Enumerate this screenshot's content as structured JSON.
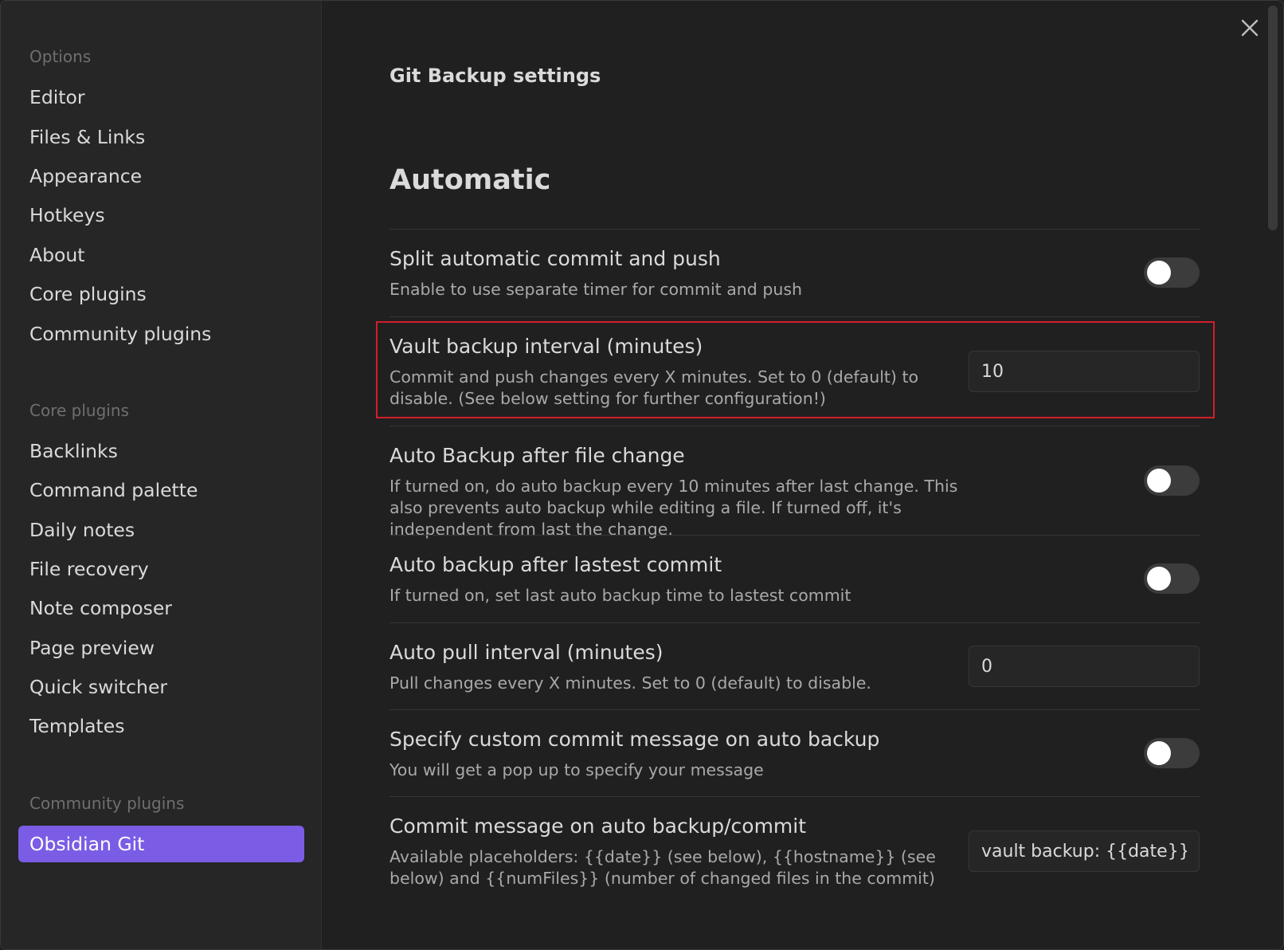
{
  "sidebar": {
    "options_heading": "Options",
    "options": [
      "Editor",
      "Files & Links",
      "Appearance",
      "Hotkeys",
      "About",
      "Core plugins",
      "Community plugins"
    ],
    "core_heading": "Core plugins",
    "core": [
      "Backlinks",
      "Command palette",
      "Daily notes",
      "File recovery",
      "Note composer",
      "Page preview",
      "Quick switcher",
      "Templates"
    ],
    "community_heading": "Community plugins",
    "community": [
      "Obsidian Git"
    ],
    "active_item": "Obsidian Git",
    "accent_color": "#7b5ce5"
  },
  "header": {
    "close_icon": "close-icon"
  },
  "main": {
    "page_title": "Git Backup settings",
    "section_title": "Automatic",
    "settings": [
      {
        "name": "Split automatic commit and push",
        "desc": "Enable to use separate timer for commit and push",
        "control": "toggle",
        "enabled": false
      },
      {
        "name": "Vault backup interval (minutes)",
        "desc": "Commit and push changes every X minutes. Set to 0 (default) to disable. (See below setting for further configuration!)",
        "control": "input",
        "value": "10",
        "highlighted": true
      },
      {
        "name": "Auto Backup after file change",
        "desc": "If turned on, do auto backup every 10 minutes after last change. This also prevents auto backup while editing a file. If turned off, it's independent from last the change.",
        "control": "toggle",
        "enabled": false
      },
      {
        "name": "Auto backup after lastest commit",
        "desc": "If turned on, set last auto backup time to lastest commit",
        "control": "toggle",
        "enabled": false
      },
      {
        "name": "Auto pull interval (minutes)",
        "desc": "Pull changes every X minutes. Set to 0 (default) to disable.",
        "control": "input",
        "value": "0"
      },
      {
        "name": "Specify custom commit message on auto backup",
        "desc": "You will get a pop up to specify your message",
        "control": "toggle",
        "enabled": false
      },
      {
        "name": "Commit message on auto backup/commit",
        "desc": "Available placeholders: {{date}} (see below), {{hostname}} (see below) and {{numFiles}} (number of changed files in the commit)",
        "control": "input",
        "value": "vault backup: {{date}}"
      }
    ]
  },
  "colors": {
    "highlight_border": "#d21f2a"
  }
}
